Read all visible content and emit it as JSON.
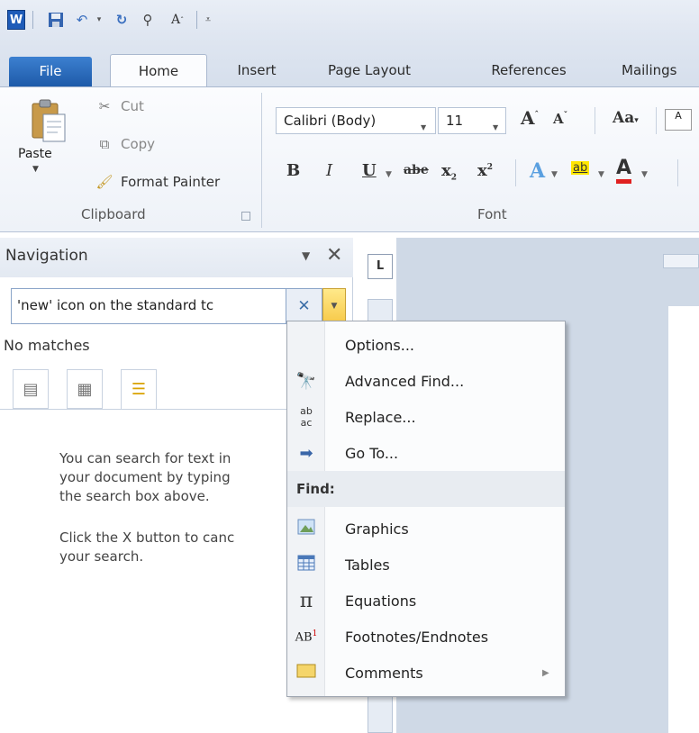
{
  "quick_access": {
    "icons": [
      "word-logo",
      "save-icon",
      "undo-icon",
      "redo-icon",
      "format-icon",
      "font-grow-icon",
      "customize-icon"
    ],
    "word_letter": "W"
  },
  "tabs": [
    {
      "label": "File"
    },
    {
      "label": "Home"
    },
    {
      "label": "Insert"
    },
    {
      "label": "Page Layout"
    },
    {
      "label": "References"
    },
    {
      "label": "Mailings"
    }
  ],
  "ribbon": {
    "clipboard": {
      "paste": "Paste",
      "cut": "Cut",
      "copy": "Copy",
      "format_painter": "Format Painter",
      "group_label": "Clipboard"
    },
    "font": {
      "font_name": "Calibri (Body)",
      "font_size": "11",
      "group_label": "Font",
      "bold": "B",
      "italic": "I",
      "underline": "U",
      "strikethrough": "abe",
      "subscript": "x",
      "superscript": "x",
      "grow": "A",
      "shrink": "A",
      "change_case": "Aa"
    }
  },
  "navigation": {
    "title": "Navigation",
    "search_value": "'new' icon on the standard tc",
    "status": "No matches",
    "help_text_1": "You can search for text in\nyour document by typing\nthe search box above.",
    "help_text_2": "Click the X button to canc\nyour search."
  },
  "ruler_corner": "L",
  "menu": {
    "items_top": [
      {
        "label": "Options...",
        "icon": "none"
      },
      {
        "label": "Advanced Find...",
        "icon": "binoculars-icon"
      },
      {
        "label": "Replace...",
        "icon": "replace-icon"
      },
      {
        "label": "Go To...",
        "icon": "arrow-right-icon"
      }
    ],
    "find_header": "Find:",
    "items_find": [
      {
        "label": "Graphics",
        "icon": "picture-icon"
      },
      {
        "label": "Tables",
        "icon": "table-icon"
      },
      {
        "label": "Equations",
        "icon": "pi-icon"
      },
      {
        "label": "Footnotes/Endnotes",
        "icon": "footnote-icon"
      },
      {
        "label": "Comments",
        "icon": "comment-icon"
      }
    ]
  },
  "colors": {
    "accent_blue": "#1e5aa9",
    "dropdown_yellow": "#f7c948"
  }
}
